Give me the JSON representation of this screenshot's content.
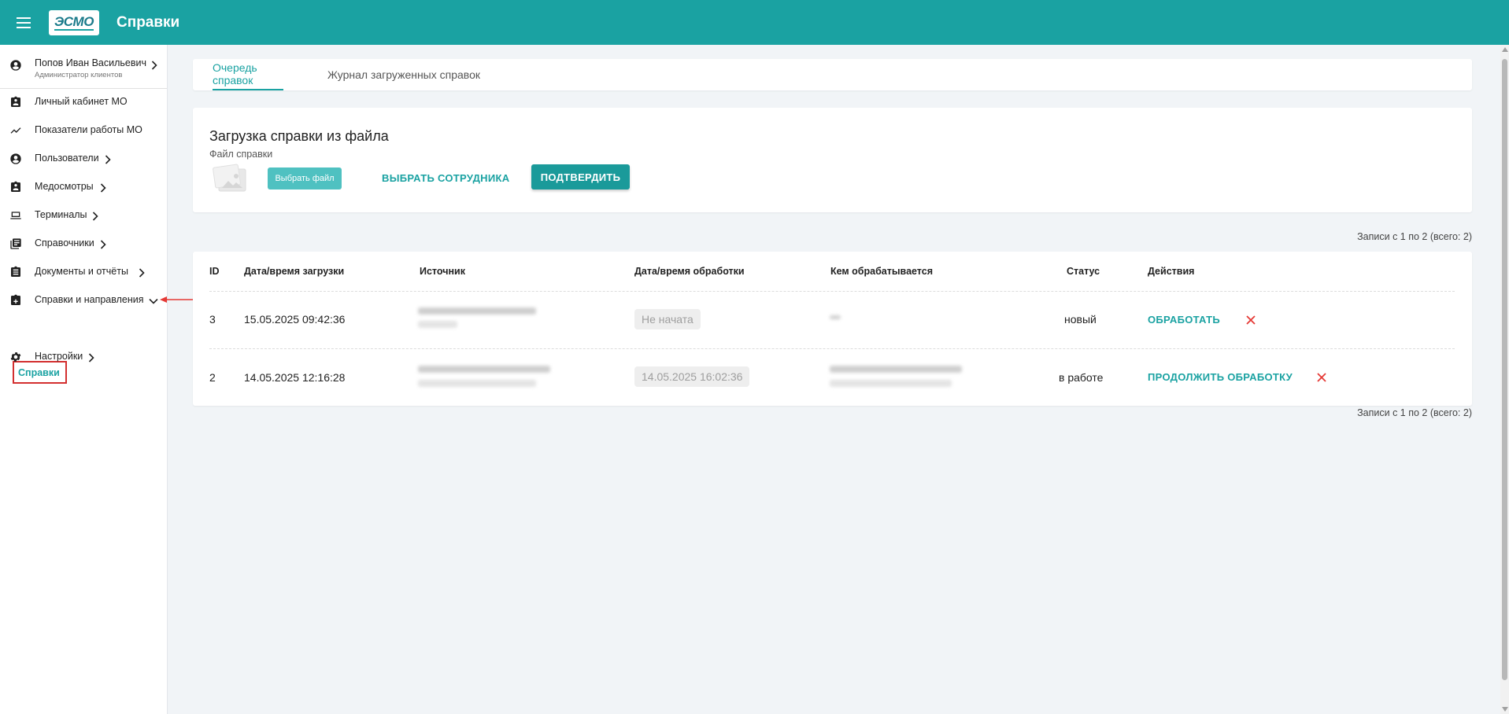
{
  "header": {
    "title": "Справки",
    "logo_text": "ЭСМО",
    "accent_color": "#1aa2a2"
  },
  "sidebar": {
    "user": {
      "name": "Попов Иван Васильевич",
      "role": "Администратор клиентов"
    },
    "items": [
      {
        "label": "Личный кабинет МО",
        "icon": "badge-icon"
      },
      {
        "label": "Показатели работы МО",
        "icon": "trend-chart-icon"
      },
      {
        "label": "Пользователи",
        "icon": "account-circle-icon"
      },
      {
        "label": "Медосмотры",
        "icon": "badge-icon"
      },
      {
        "label": "Терминалы",
        "icon": "laptop-icon"
      },
      {
        "label": "Справочники",
        "icon": "book-list-icon"
      },
      {
        "label": "Документы и отчёты",
        "icon": "clipboard-icon"
      },
      {
        "label": "Справки и направления",
        "icon": "medical-clipboard-icon"
      },
      {
        "label": "Настройки",
        "icon": "gear-icon"
      }
    ],
    "sub_item": "Справки"
  },
  "tabs": [
    {
      "label": "Очередь справок",
      "active": true
    },
    {
      "label": "Журнал загруженных справок",
      "active": false
    }
  ],
  "upload": {
    "title": "Загрузка справки из файла",
    "file_label": "Файл справки",
    "choose_file_label": "Выбрать файл",
    "choose_employee_label": "ВЫБРАТЬ СОТРУДНИКА",
    "confirm_label": "ПОДТВЕРДИТЬ"
  },
  "records_text": "Записи с 1 по 2 (всего: 2)",
  "table": {
    "columns": [
      "ID",
      "Дата/время загрузки",
      "Источник",
      "Дата/время обработки",
      "Кем обрабатывается",
      "Статус",
      "Действия"
    ],
    "rows": [
      {
        "id": "3",
        "uploaded": "15.05.2025 09:42:36",
        "processed": "Не начата",
        "status": "новый",
        "action": "ОБРАБОТАТЬ"
      },
      {
        "id": "2",
        "uploaded": "14.05.2025 12:16:28",
        "processed": "14.05.2025 16:02:36",
        "status": "в работе",
        "action": "ПРОДОЛЖИТЬ ОБРАБОТКУ"
      }
    ]
  }
}
